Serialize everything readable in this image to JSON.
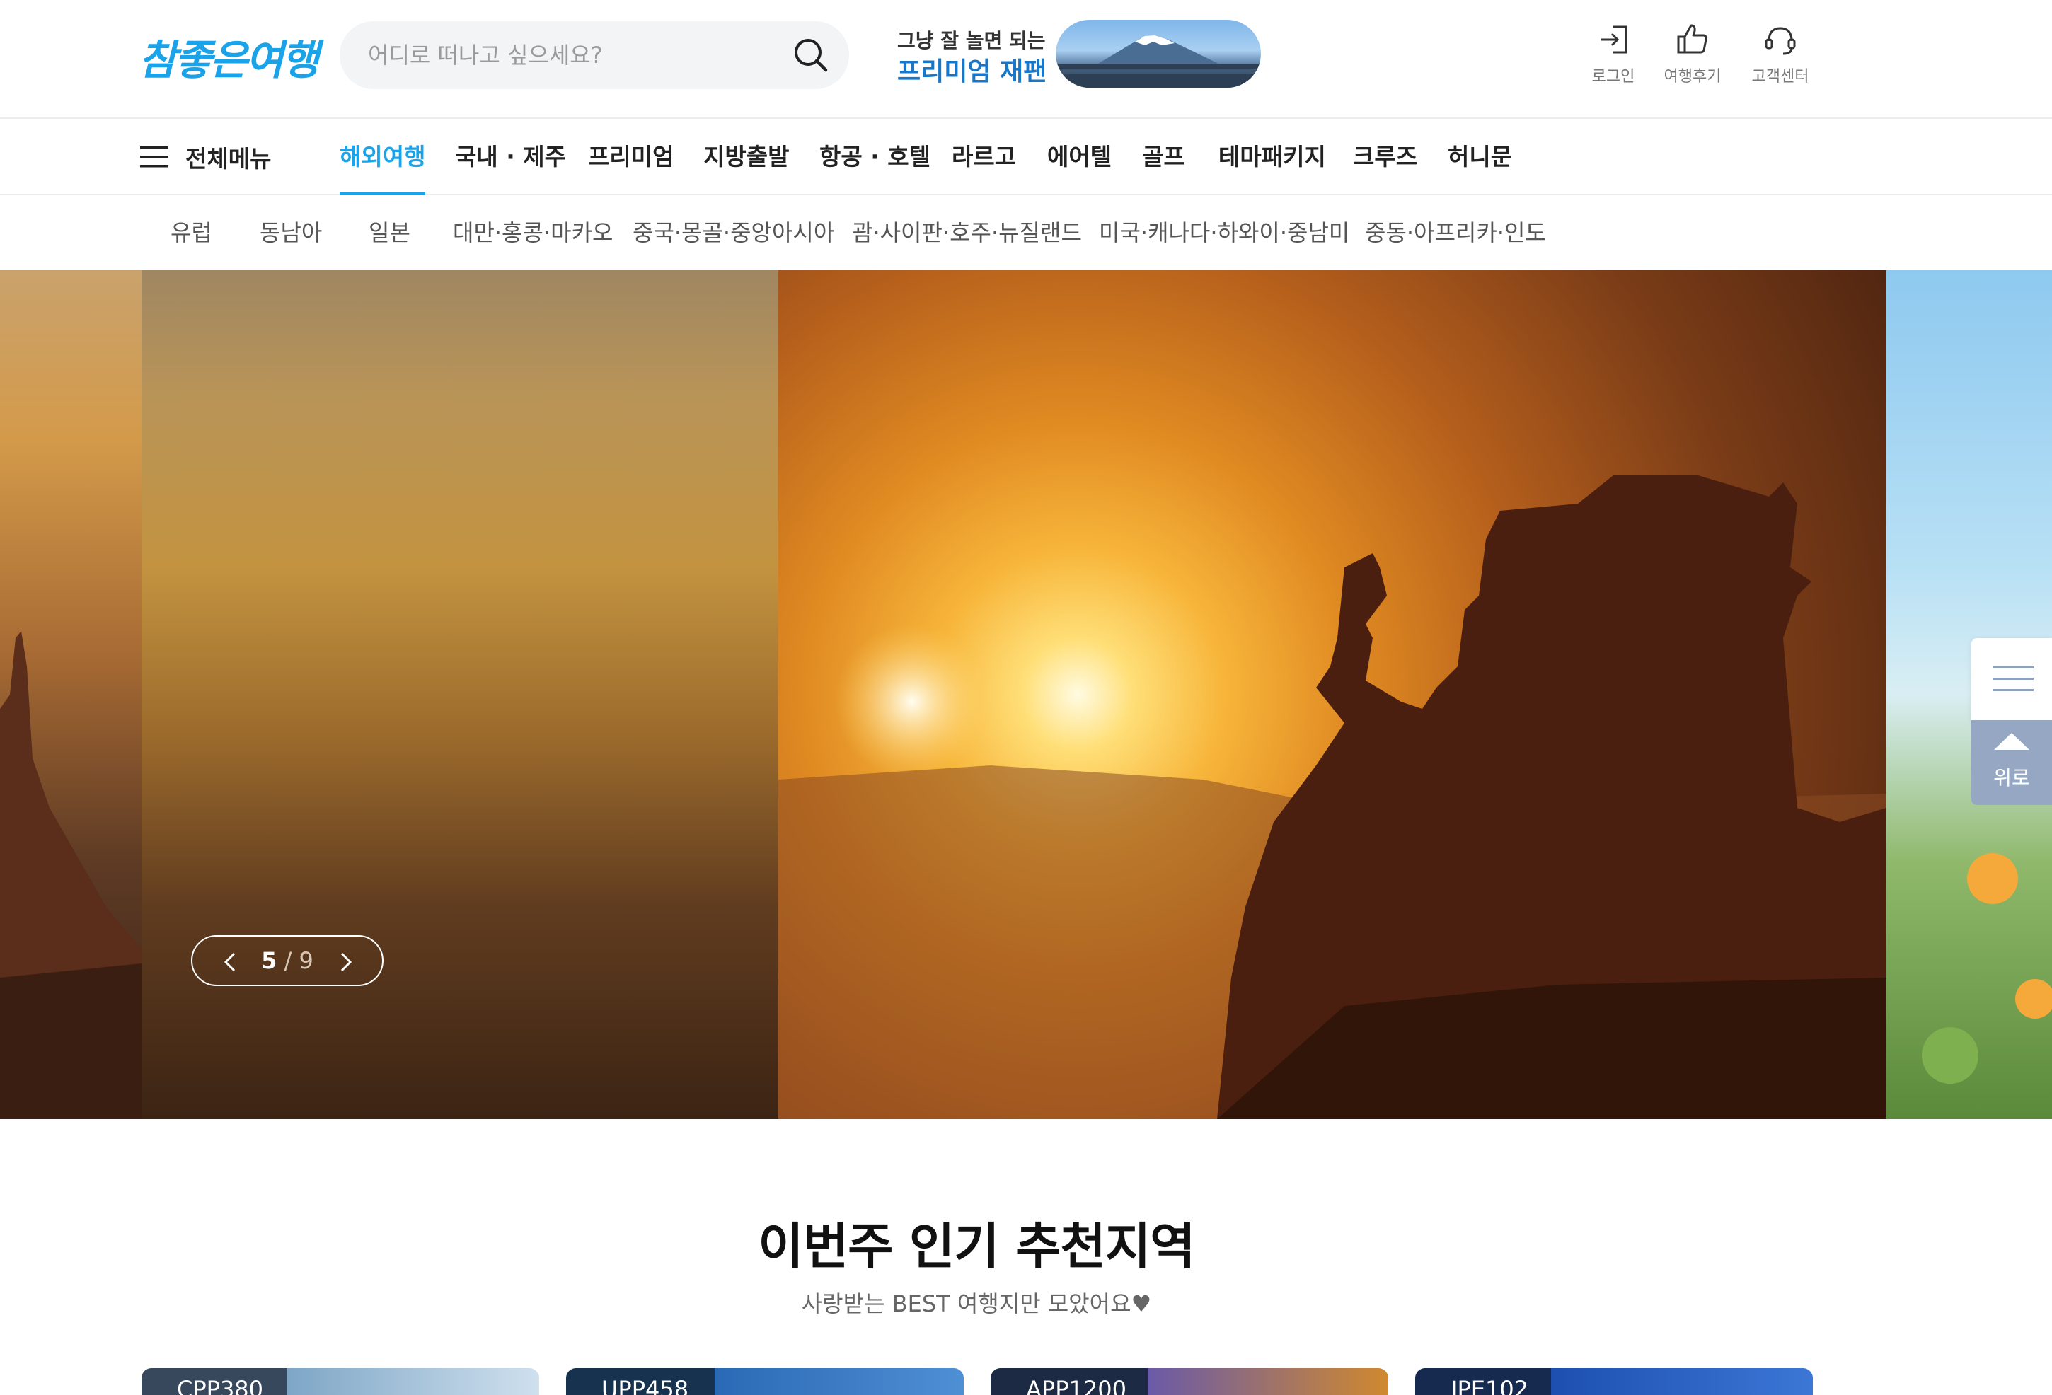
{
  "header": {
    "logo": "참좋은여행",
    "search_placeholder": "어디로 떠나고 싶으세요?",
    "promo_sub": "그냥 잘 놀면 되는",
    "promo_main": "프리미엄 재팬",
    "util": [
      {
        "label": "로그인",
        "icon": "login-icon"
      },
      {
        "label": "여행후기",
        "icon": "thumbs-up-icon"
      },
      {
        "label": "고객센터",
        "icon": "headset-icon"
      }
    ]
  },
  "gnb": {
    "all_menu": "전체메뉴",
    "items": [
      "해외여행",
      "국내 · 제주",
      "프리미엄",
      "지방출발",
      "항공 · 호텔",
      "라르고",
      "에어텔",
      "골프",
      "테마패키지",
      "크루즈",
      "허니문"
    ],
    "active": "해외여행"
  },
  "subnav": {
    "items": [
      "유럽",
      "동남아",
      "일본",
      "대만·홍콩·마카오",
      "중국·몽골·중앙아시아",
      "괌·사이판·호주·뉴질랜드",
      "미국·캐나다·하와이·중남미",
      "중동·아프리카·인도"
    ]
  },
  "hero": {
    "current": "5",
    "separator": "/",
    "total": "9"
  },
  "floating": {
    "top_label": "위로"
  },
  "section": {
    "title": "이번주 인기 추천지역",
    "subtitle": "사랑받는 BEST 여행지만 모았어요♥",
    "cards": [
      {
        "code": "CPP380"
      },
      {
        "code": "UPP458"
      },
      {
        "code": "APP1200"
      },
      {
        "code": "JPE102"
      }
    ]
  },
  "colors": {
    "accent": "#1aa3e8",
    "promo_blue": "#1877c9",
    "float_top": "#95a7c3"
  }
}
